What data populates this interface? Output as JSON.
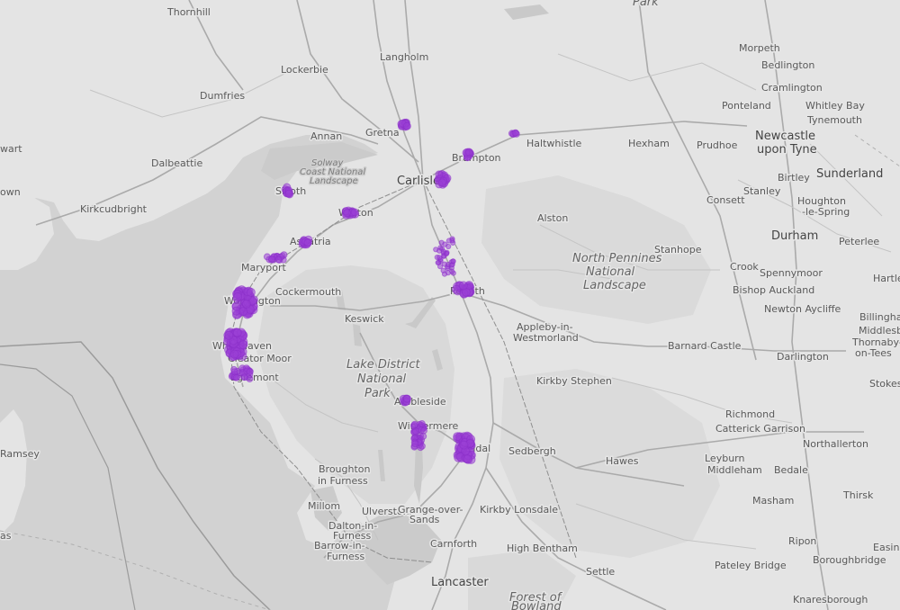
{
  "map": {
    "basemap": "light grey",
    "point_color": "#8a2fc8",
    "labels": {
      "thornhill": "Thornhill",
      "park_top": "Park",
      "morpeth": "Morpeth",
      "bedlington": "Bedlington",
      "lockerbie": "Lockerbie",
      "langholm": "Langholm",
      "cramlington": "Cramlington",
      "ponteland": "Ponteland",
      "whitley_bay": "Whitley Bay",
      "dumfries": "Dumfries",
      "tynemouth": "Tynemouth",
      "annan": "Annan",
      "gretna": "Gretna",
      "haltwhistle": "Haltwhistle",
      "hexham": "Hexham",
      "prudhoe": "Prudhoe",
      "newcastle_1": "Newcastle",
      "newcastle_2": "upon Tyne",
      "stewart": "wart",
      "brampton": "Brampton",
      "dalbeattie": "Dalbeattie",
      "solway_1": "Solway",
      "solway_2": "Coast National",
      "solway_3": "Landscape",
      "carlisle": "Carlisle",
      "sunderland": "Sunderland",
      "birtley": "Birtley",
      "town_left": "own",
      "silloth": "Silloth",
      "consett": "Consett",
      "stanley": "Stanley",
      "houghton_1": "Houghton",
      "houghton_2": "-le-Spring",
      "kirkcudbright": "Kirkcudbright",
      "wigton": "Wigton",
      "alston": "Alston",
      "durham": "Durham",
      "aspatria": "Aspatria",
      "stanhope": "Stanhope",
      "peterlee": "Peterlee",
      "np_north_1": "North Pennines",
      "np_north_2": "National",
      "np_north_3": "Landscape",
      "maryport": "Maryport",
      "crook": "Crook",
      "spennymoor": "Spennymoor",
      "hartlepool": "Hartlep",
      "cockermouth": "Cockermouth",
      "workington": "Workington",
      "penrith": "Penrith",
      "bishop_auckland": "Bishop Auckland",
      "newton_aycliffe": "Newton Aycliffe",
      "billingham": "Billingham",
      "keswick": "Keswick",
      "appleby_1": "Appleby-in-",
      "appleby_2": "Westmorland",
      "middlesbrough": "Middlesbro",
      "thornaby_1": "Thornaby-",
      "thornaby_2": "on-Tees",
      "whitehaven": "Whitehaven",
      "barnard_castle": "Barnard Castle",
      "cleator_moor": "Cleator Moor",
      "darlington": "Darlington",
      "lake_1": "Lake District",
      "lake_2": "National",
      "lake_3": "Park",
      "egremont": "Egremont",
      "kirkby_stephen": "Kirkby Stephen",
      "stokesley": "Stokes",
      "ambleside": "Ambleside",
      "richmond": "Richmond",
      "catterick": "Catterick Garrison",
      "windermere": "Windermere",
      "northallerton": "Northallerton",
      "kendal": "Kendal",
      "ramsey": "Ramsey",
      "sedbergh": "Sedbergh",
      "hawes": "Hawes",
      "leyburn": "Leyburn",
      "middleham": "Middleham",
      "bedale": "Bedale",
      "broughton_1": "Broughton",
      "broughton_2": "in Furness",
      "thirsk": "Thirsk",
      "millom": "Millom",
      "masham": "Masham",
      "ulverston": "Ulverston",
      "grange_1": "Grange-over-",
      "grange_2": "Sands",
      "kirkby_lonsdale": "Kirkby Lonsdale",
      "dalton_1": "Dalton-in-",
      "dalton_2": "Furness",
      "carnforth": "Carnforth",
      "ripon": "Ripon",
      "easingwold": "Easingw",
      "barrow_1": "Barrow-in-",
      "barrow_2": "Furness",
      "high_bentham": "High Bentham",
      "pateley_bridge": "Pateley Bridge",
      "boroughbridge": "Boroughbridge",
      "settle": "Settle",
      "lancaster": "Lancaster",
      "forest_1": "Forest of",
      "forest_2": "Bowland",
      "knaresborough": "Knaresborough",
      "isle_left": "as"
    },
    "clusters": {
      "gretna_north": "Gretna cluster",
      "haltwhistle_west": "Haltwhistle west cluster",
      "brampton": "Brampton cluster",
      "carlisle_east": "Carlisle east cluster",
      "silloth": "Silloth cluster",
      "wigton": "Wigton cluster",
      "aspatria": "Aspatria cluster",
      "maryport": "Maryport cluster",
      "workington": "Workington cluster",
      "whitehaven": "Whitehaven cluster",
      "egremont": "Egremont cluster",
      "m6_corridor": "M6 corridor cluster",
      "penrith": "Penrith cluster",
      "ambleside": "Ambleside cluster",
      "windermere": "Windermere cluster",
      "kendal": "Kendal cluster"
    }
  }
}
